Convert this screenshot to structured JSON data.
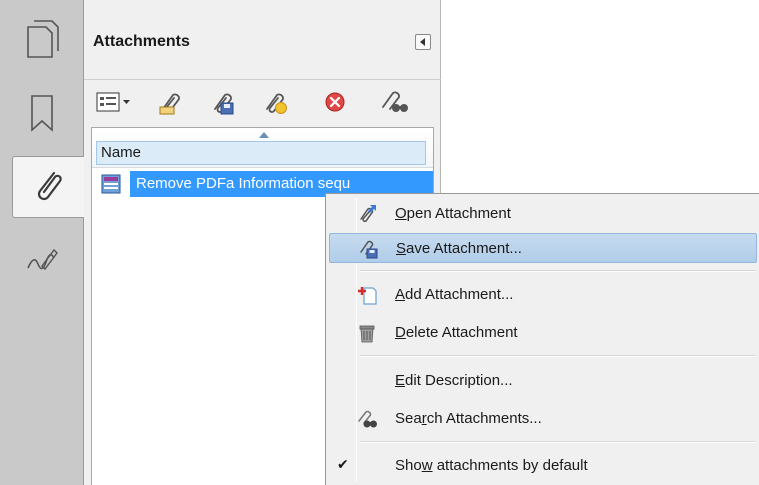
{
  "panel": {
    "title": "Attachments"
  },
  "list": {
    "column_name": "Name",
    "rows": [
      {
        "name": "Remove PDFa Information sequ"
      }
    ]
  },
  "menu": {
    "items": [
      {
        "id": "open",
        "pre": "",
        "key": "O",
        "post": "pen Attachment",
        "icon": "open-attachment-icon"
      },
      {
        "id": "save",
        "pre": "",
        "key": "S",
        "post": "ave Attachment...",
        "icon": "save-attachment-icon"
      },
      {
        "id": "add",
        "pre": "",
        "key": "A",
        "post": "dd Attachment...",
        "icon": "add-attachment-icon"
      },
      {
        "id": "delete",
        "pre": "",
        "key": "D",
        "post": "elete Attachment",
        "icon": "delete-attachment-icon"
      },
      {
        "id": "edit",
        "pre": "",
        "key": "E",
        "post": "dit Description...",
        "icon": ""
      },
      {
        "id": "search",
        "pre": "Sea",
        "key": "r",
        "post": "ch Attachments...",
        "icon": "search-attachments-icon"
      },
      {
        "id": "show",
        "pre": "Sho",
        "key": "w",
        "post": " attachments by default",
        "icon": "",
        "check": "✔"
      }
    ]
  },
  "colors": {
    "selection": "#3399ff",
    "menu_highlight": "#b1cde8",
    "rail": "#c9c9c9"
  }
}
